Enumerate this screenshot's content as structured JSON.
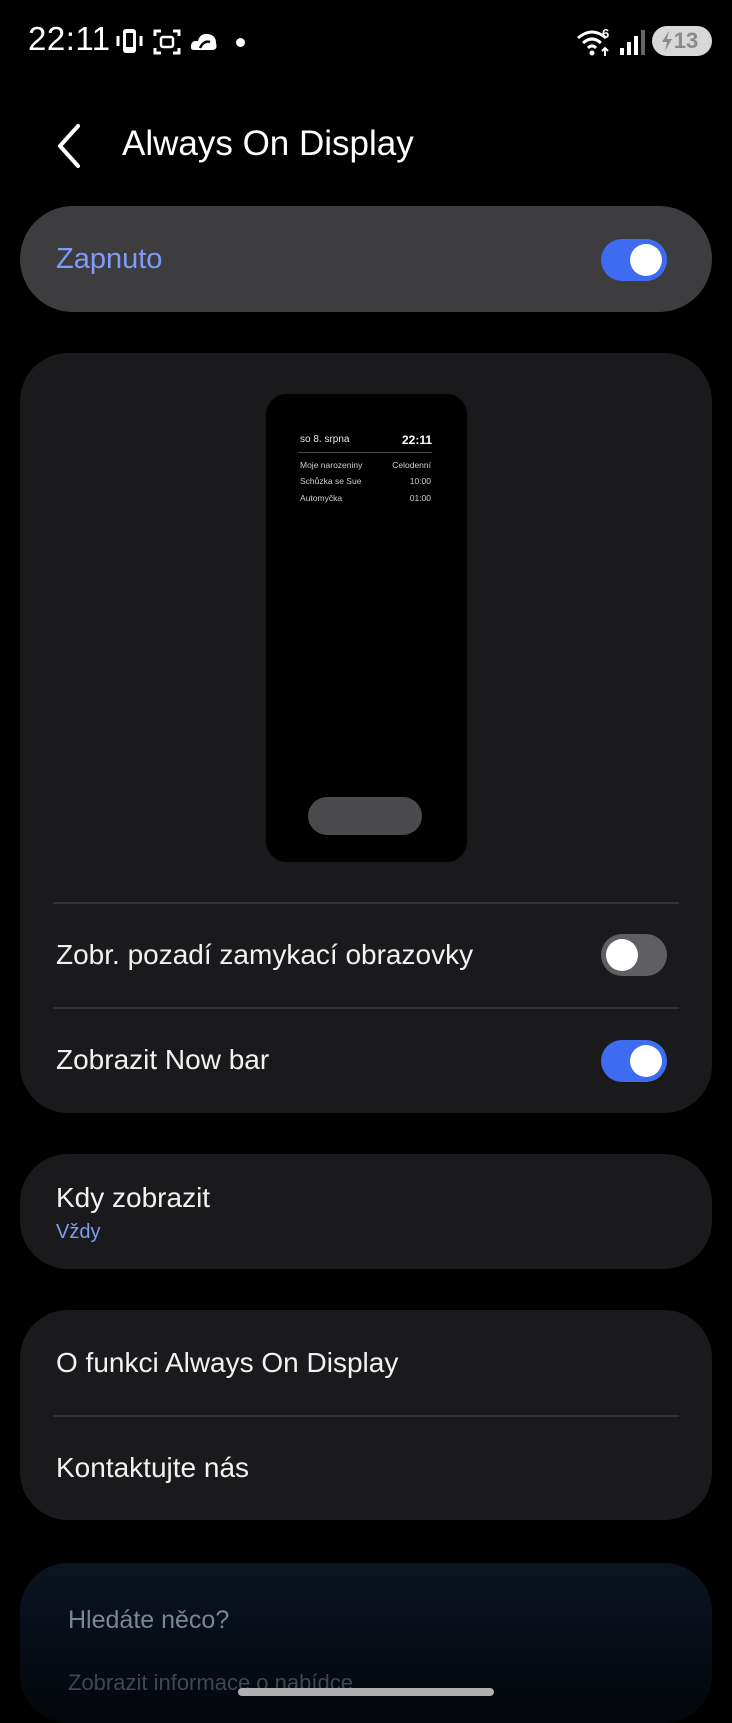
{
  "status_bar": {
    "time": "22:11",
    "icons": [
      "phone-vibrate-icon",
      "screenshot-icon",
      "weather-cloud-icon",
      "notification-dot-icon",
      "wifi-6-icon",
      "signal-icon"
    ],
    "battery_level": "13",
    "wifi_badge": "6"
  },
  "header": {
    "title": "Always On Display",
    "back_icon": "chevron-left-icon"
  },
  "master_switch": {
    "label": "Zapnuto",
    "state": "on"
  },
  "preview": {
    "date": "so 8. srpna",
    "time": "22:11",
    "events": [
      {
        "name": "Moje narozeniny",
        "time": "Celodenní"
      },
      {
        "name": "Schůzka se Sue",
        "time": "10:00"
      },
      {
        "name": "Automyčka",
        "time": "01:00"
      }
    ]
  },
  "settings": {
    "lockscreen_wallpaper": {
      "label": "Zobr. pozadí zamykací obrazovky",
      "state": "off"
    },
    "now_bar": {
      "label": "Zobrazit Now bar",
      "state": "on"
    }
  },
  "when_to_show": {
    "label": "Kdy zobrazit",
    "value": "Vždy"
  },
  "info": {
    "about": "O funkci Always On Display",
    "contact": "Kontaktujte nás"
  },
  "search_suggest": {
    "title": "Hledáte něco?",
    "link": "Zobrazit informace o nabídce"
  },
  "colors": {
    "accent": "#3e6cf0",
    "accent_text": "#7e9bf5",
    "card": "#1a1a1c",
    "master_card": "#3d3d40"
  }
}
